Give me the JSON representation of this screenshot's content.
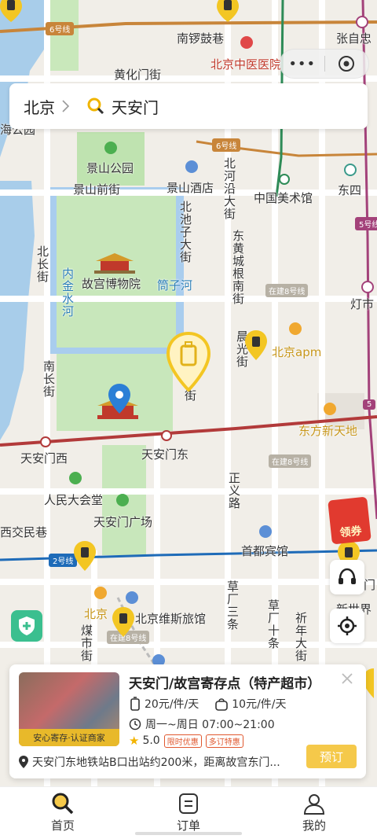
{
  "search": {
    "city": "北京",
    "query": "天安门"
  },
  "map": {
    "labels": {
      "nanluoguxiang": "南锣鼓巷",
      "zhangzizhong": "张自忠",
      "huangchengmen": "黄化门街",
      "tcm_hospital": "北京中医医院",
      "haiyunchi": "海公园",
      "jingshan_park": "景山公园",
      "jingshan_front": "景山前街",
      "jingshan_hotel": "景山酒店",
      "beiheyan": "北河沿大街",
      "art_museum": "中国美术馆",
      "dongsi": "东四",
      "beichizi": "北池子大街",
      "donghuangcheng": "东黄城根南街",
      "palace_museum": "故宫博物院",
      "tongzihe": "筒子河",
      "neijinshui": "内金水河",
      "beichang": "北长街",
      "dengshikou": "灯市",
      "nanchang": "南长街",
      "chenguang": "晨光街",
      "beijing_apm": "北京apm",
      "jie": "街",
      "dongfang": "东方新天地",
      "tam_west": "天安门西",
      "tam_east": "天安门东",
      "zhengyi": "正义路",
      "great_hall": "人民大会堂",
      "tam_square": "天安门广场",
      "xijiaominxiang": "西交民巷",
      "capital_hotel": "首都宾馆",
      "caochangsantiao": "草厂三条",
      "caochangshitiao": "草厂十条",
      "qinian": "祈年大街",
      "xinshijie": "新世界",
      "beijing_station_partial": "北京",
      "weisi_hotel": "北京维斯旅馆",
      "meishijie": "煤市街",
      "wenhuamen": "文门"
    },
    "line_tags": {
      "line6_top": "6号线",
      "line6": "6号线",
      "line5": "5号线",
      "line5b": "5",
      "line2": "2号线",
      "line8_a": "在建8号线",
      "line8_b": "在建8号线",
      "line8_c": "在建8号线"
    },
    "promo_label": "领券"
  },
  "card": {
    "title": "天安门/故宫寄存点（特产超市）",
    "thumb_badge": "安心寄存·认证商家",
    "price_large": "20元/件/天",
    "price_small": "10元/件/天",
    "hours": "周一~周日 07:00~21:00",
    "rating": "5.0",
    "chips": [
      "限时优惠",
      "多订特惠"
    ],
    "address": "天安门东地铁站B口出站约200米，距离故宫东门...",
    "book_label": "预订"
  },
  "tabs": [
    {
      "label": "首页",
      "icon": "search-icon",
      "active": true
    },
    {
      "label": "订单",
      "icon": "order-icon",
      "active": false
    },
    {
      "label": "我的",
      "icon": "user-icon",
      "active": false
    }
  ],
  "colors": {
    "accent": "#f5c94a",
    "marker": "#f3c623",
    "pin": "#2b7fd6",
    "line6": "#c8853a",
    "line2": "#1e6bb8",
    "line1": "#c0392b"
  }
}
